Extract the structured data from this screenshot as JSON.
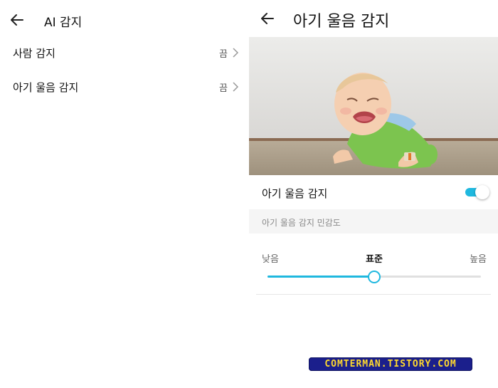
{
  "left": {
    "header": {
      "title": "AI 감지"
    },
    "items": [
      {
        "label": "사람 감지",
        "value": "끔"
      },
      {
        "label": "아기 울음 감지",
        "value": "끔"
      }
    ]
  },
  "right": {
    "header": {
      "title": "아기 울음 감지"
    },
    "toggle": {
      "label": "아기 울음 감지",
      "on": true
    },
    "sensitivity": {
      "section_label": "아기 울음 감지 민감도",
      "low_label": "낮음",
      "mid_label": "표준",
      "high_label": "높음",
      "level": 0.5
    }
  },
  "watermark": {
    "text": "COMTERMAN.TISTORY.COM"
  },
  "colors": {
    "accent": "#1fb8df",
    "watermark_bg": "#1b1f8c",
    "watermark_text": "#ffd92e"
  }
}
